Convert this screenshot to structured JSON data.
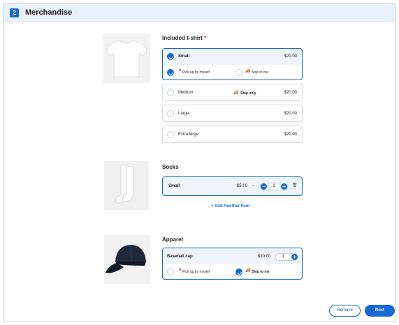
{
  "header": {
    "step": "2",
    "title": "Merchandise"
  },
  "tshirt": {
    "title": "Included t-shirt",
    "required_mark": "*",
    "options": [
      {
        "label": "Small",
        "price": "$20.00",
        "selected": true,
        "fulfillment": {
          "pickup_label": "Pick up by myself",
          "ship_label": "Ship to me",
          "selected": "pickup"
        }
      },
      {
        "label": "Medium",
        "badge": "Ship only",
        "price": "$20.00"
      },
      {
        "label": "Large",
        "price": "$20.00"
      },
      {
        "label": "Extra large",
        "price": "$20.00"
      }
    ]
  },
  "socks": {
    "title": "Socks",
    "item": {
      "label": "Small",
      "price": "$5.00",
      "quantity": "1"
    },
    "add_link": "+ Add Another Item"
  },
  "apparel": {
    "title": "Apparel",
    "item": {
      "label": "Baseball cap",
      "price": "$10.00",
      "quantity": "1",
      "pickup_label": "Pick up by myself",
      "ship_label": "Ship to me",
      "selected": "ship"
    }
  },
  "footer": {
    "remove_label": "Remove",
    "next_label": "Next"
  },
  "colors": {
    "accent": "#1669d6",
    "header_bg": "#e9f1fb",
    "selected_bg": "#eef4fc"
  },
  "icons": [
    "check-icon",
    "location-pin-icon",
    "truck-icon",
    "chevron-down-icon",
    "minus-icon",
    "plus-icon",
    "trash-icon"
  ]
}
